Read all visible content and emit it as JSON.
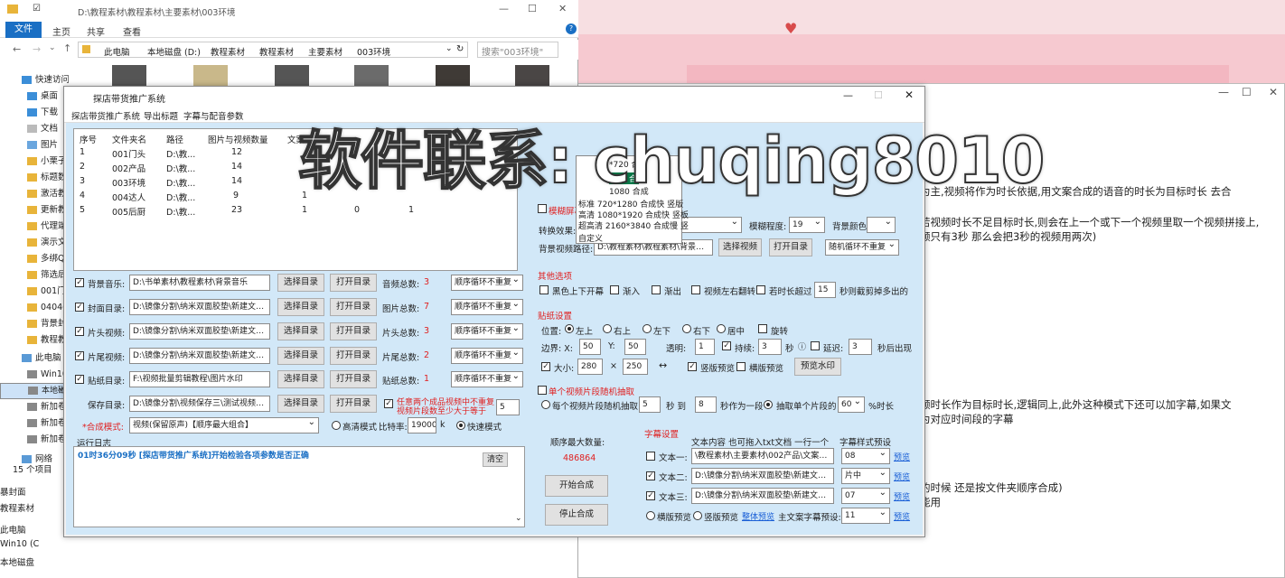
{
  "background": {
    "doc_paragraphs": [
      "为主,视频将作为时长依据,用文案合成的语音的时长为目标时长 去合",
      "若视频时长不足目标时长,则会在上一个或下一个视频里取一个视频拼接上,",
      "频只有3秒 那么会把3秒的视频用两次)",
      "频时长作为目标时长,逻辑同上,此外这种模式下还可以加字幕,如果文",
      "为对应时间段的字幕",
      "的时候 还是按文件夹顺序合成)",
      "能用"
    ]
  },
  "explorer": {
    "title": "D:\\教程素材\\教程素材\\主要素材\\003环境",
    "ribbon_tabs": [
      "文件",
      "主页",
      "共享",
      "查看"
    ],
    "breadcrumb": [
      "此电脑",
      "本地磁盘 (D:)",
      "教程素材",
      "教程素材",
      "主要素材",
      "003环境"
    ],
    "search_placeholder": "搜索\"003环境\"",
    "nav_items": [
      "快速访问",
      "桌面",
      "下载",
      "文档",
      "图片",
      "小栗子",
      "标题数",
      "激活教",
      "更新教",
      "代理端",
      "演示文",
      "多绑Q",
      "筛选后",
      "001门",
      "04046",
      "背景封",
      "教程教",
      "此电脑",
      "Win10",
      "本地磁",
      "新加卷",
      "新加卷",
      "新加卷",
      "网络"
    ],
    "status": "15 个项目",
    "bottom_items": [
      "暴封面",
      "教程素材",
      "此电脑",
      "Win10 (C",
      "本地磁盘"
    ]
  },
  "tool": {
    "title": "探店带货推广系统",
    "menu": [
      "探店带货推广系统",
      "导出标题",
      "字幕与配音参数"
    ],
    "list_headers": [
      "序号",
      "文件夹名",
      "路径",
      "图片与视频数量",
      "文案"
    ],
    "list_rows": [
      [
        "1",
        "001门头",
        "D:\\教...",
        "12",
        ""
      ],
      [
        "2",
        "002产品",
        "D:\\教...",
        "14",
        ""
      ],
      [
        "3",
        "003环境",
        "D:\\教...",
        "14",
        ""
      ],
      [
        "4",
        "004达人",
        "D:\\教...",
        "9",
        "1"
      ],
      [
        "5",
        "005后厨",
        "D:\\教...",
        "23",
        "1"
      ]
    ],
    "row5_extra": [
      "0",
      "1"
    ],
    "rows": [
      {
        "label": "背景音乐:",
        "path": "D:\\书单素材\\教程素材\\背景音乐",
        "count_label": "音频总数:",
        "count": "3",
        "mode": "顺序循环不重复",
        "checked": "✓"
      },
      {
        "label": "封面目录:",
        "path": "D:\\镜像分割\\纳米双面胶垫\\新建文件夹",
        "count_label": "图片总数:",
        "count": "7",
        "mode": "顺序循环不重复",
        "checked": "✓"
      },
      {
        "label": "片头视频:",
        "path": "D:\\镜像分割\\纳米双面胶垫\\新建文件夹",
        "count_label": "片头总数:",
        "count": "3",
        "mode": "顺序循环不重复",
        "checked": "✓"
      },
      {
        "label": "片尾视频:",
        "path": "D:\\镜像分割\\纳米双面胶垫\\新建文件夹",
        "count_label": "片尾总数:",
        "count": "2",
        "mode": "顺序循环不重复",
        "checked": "✓"
      },
      {
        "label": "贴纸目录:",
        "path": "F:\\视频批量剪辑教程\\图片水印",
        "count_label": "贴纸总数:",
        "count": "1",
        "mode": "顺序循环不重复",
        "checked": "✓"
      }
    ],
    "btn_select": "选择目录",
    "btn_open": "打开目录",
    "save_label": "保存目录:",
    "save_path": "D:\\镜像分割\\视频保存三\\测试视频\\04C",
    "warn_text1": "任意两个成品视频中不重复",
    "warn_text2": "视频片段数至少大于等于",
    "warn_value": "5",
    "compose_label": "*合成模式:",
    "compose_value": "视频(保留原声)【顺序最大组合】",
    "hq_label": "高清模式",
    "bitrate_label": "比特率:",
    "bitrate_value": "19000",
    "bitrate_unit": "k",
    "fast_label": "快速模式",
    "log_label": "运行日志",
    "log_text": "01时36分09秒 [探店带货推广系统]开始检验各项参数是否正确",
    "clear_btn": "清空",
    "max_label": "顺序最大数量:",
    "max_value": "486864",
    "start_btn": "开始合成",
    "stop_btn": "停止合成",
    "transition": {
      "label": "转换效果:",
      "blur_label": "模糊程度:",
      "blur_value": "19",
      "bg_color_label": "背景颜色:",
      "bgpath_label": "背景视频路径:",
      "bgpath_value": "D:\\教程素材\\教程素材\\背景封面",
      "select_video": "选择视频",
      "open_dir": "打开目录",
      "random_mode": "随机循环不重复",
      "blur_screen": "模糊屏幕"
    },
    "other": {
      "title": "其他选项",
      "opts": [
        "黑色上下开幕",
        "渐入",
        "渐出",
        "视频左右翻转",
        "若时长超过"
      ],
      "dur_value": "15",
      "dur_suffix": "秒则截剪掉多出的"
    },
    "sticker": {
      "title": "贴纸设置",
      "pos_label": "位置:",
      "positions": [
        "左上",
        "右上",
        "左下",
        "右下",
        "居中",
        "旋转"
      ],
      "border_label": "边界: X:",
      "x": "50",
      "y_label": "Y:",
      "y": "50",
      "alpha_label": "透明:",
      "alpha": "1",
      "last_label": "持续:",
      "last": "3",
      "sec": "秒",
      "delay_label": "延迟:",
      "delay": "3",
      "after": "秒后出现",
      "size_label": "大小:",
      "w": "280",
      "times": "×",
      "h": "250",
      "arrow": "↔",
      "vpreview": "竖版预览",
      "hpreview": "横版预览",
      "preview_btn": "预览水印"
    },
    "single": {
      "title": "单个视频片段随机抽取",
      "opt1": "每个视频片段随机抽取",
      "v1": "5",
      "to": "秒 到",
      "v2": "8",
      "as": "秒作为一段",
      "opt2": "抽取单个片段的",
      "pct": "60",
      "pct_suffix": "%时长"
    },
    "subtitle": {
      "title": "字幕设置",
      "col1": "文本内容 也可拖入txt文档 一行一个",
      "col2": "字幕样式预设",
      "lines": [
        {
          "label": "文本一:",
          "path": "\\教程素材\\主要素材\\002产品\\文案2.txt",
          "style": "08",
          "checked": ""
        },
        {
          "label": "文本二:",
          "path": "D:\\镜像分割\\纳米双面胶垫\\新建文件夹",
          "style": "片中",
          "checked": "✓"
        },
        {
          "label": "文本三:",
          "path": "D:\\镜像分割\\纳米双面胶垫\\新建文件夹",
          "style": "07",
          "checked": "✓"
        }
      ],
      "preview": "预览",
      "h_preview": "横版预览",
      "v_preview": "竖版预览",
      "whole": "整体预览",
      "main_preset": "主文案字幕预设:",
      "main_value": "11"
    },
    "dropdown": [
      "*720 合",
      "720 合",
      "1080 合成",
      "标准 720*1280 合成快 竖版",
      "高清 1080*1920 合成快 竖板",
      "超高清 2160*3840 合成慢 竖",
      "自定义"
    ]
  },
  "watermark": "软件联系: chuqing8010"
}
